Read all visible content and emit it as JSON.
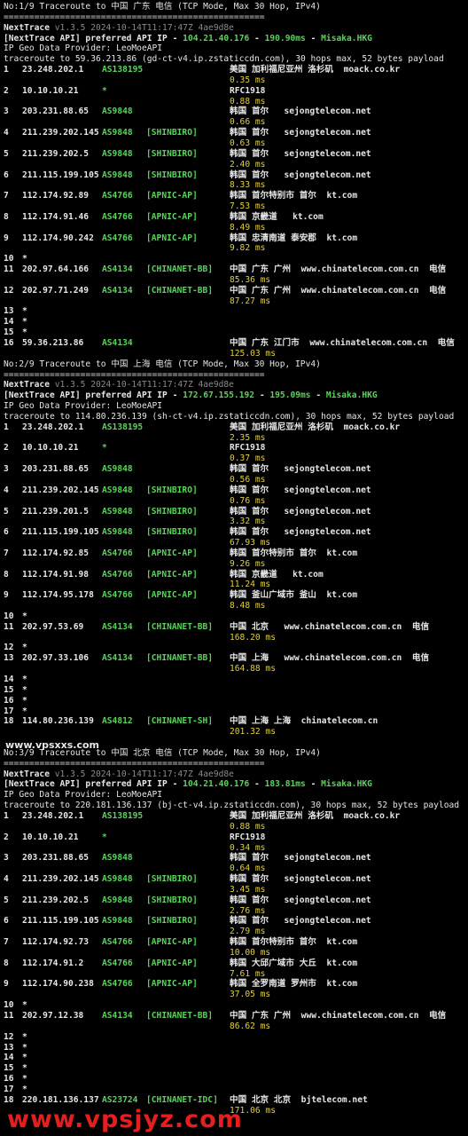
{
  "sections": [
    {
      "title": "No:1/9 Traceroute to 中国 广东 电信 (TCP Mode, Max 30 Hop, IPv4)",
      "rule": "===================================================",
      "version": "v1.3.5 2024-10-14T11:17:47Z 4ae9d8e",
      "api_ip": "104.21.40.176",
      "api_ms": "190.90ms",
      "api_name": "Misaka.HKG",
      "provider": "IP Geo Data Provider: LeoMoeAPI",
      "trace_line": "traceroute to 59.36.213.86 (gd-ct-v4.ip.zstaticcdn.com), 30 hops max, 52 bytes payload",
      "hops": [
        {
          "n": "1",
          "ip": "23.248.202.1",
          "as": "AS138195",
          "tag": "",
          "geo": "美国 加利福尼亚州 洛杉矶  moack.co.kr",
          "rtt": "0.35 ms"
        },
        {
          "n": "2",
          "ip": "10.10.10.21",
          "as": "*",
          "tag": "",
          "geo": "RFC1918",
          "rtt": "0.88 ms"
        },
        {
          "n": "3",
          "ip": "203.231.88.65",
          "as": "AS9848",
          "tag": "",
          "geo": "韩国 首尔   sejongtelecom.net",
          "rtt": "0.66 ms"
        },
        {
          "n": "4",
          "ip": "211.239.202.145",
          "as": "AS9848",
          "tag": "[SHINBIRO]",
          "geo": "韩国 首尔   sejongtelecom.net",
          "rtt": "0.63 ms"
        },
        {
          "n": "5",
          "ip": "211.239.202.5",
          "as": "AS9848",
          "tag": "[SHINBIRO]",
          "geo": "韩国 首尔   sejongtelecom.net",
          "rtt": "2.40 ms"
        },
        {
          "n": "6",
          "ip": "211.115.199.105",
          "as": "AS9848",
          "tag": "[SHINBIRO]",
          "geo": "韩国 首尔   sejongtelecom.net",
          "rtt": "8.33 ms"
        },
        {
          "n": "7",
          "ip": "112.174.92.89",
          "as": "AS4766",
          "tag": "[APNIC-AP]",
          "geo": "韩国 首尔特别市 首尔  kt.com",
          "rtt": "7.53 ms"
        },
        {
          "n": "8",
          "ip": "112.174.91.46",
          "as": "AS4766",
          "tag": "[APNIC-AP]",
          "geo": "韩国 京畿道   kt.com",
          "rtt": "8.49 ms"
        },
        {
          "n": "9",
          "ip": "112.174.90.242",
          "as": "AS4766",
          "tag": "[APNIC-AP]",
          "geo": "韩国 忠清南道 泰安郡  kt.com",
          "rtt": "9.82 ms"
        },
        {
          "n": "10",
          "ip": "*",
          "as": "",
          "tag": "",
          "geo": "",
          "rtt": ""
        },
        {
          "n": "11",
          "ip": "202.97.64.166",
          "as": "AS4134",
          "tag": "[CHINANET-BB]",
          "geo": "中国 广东 广州  www.chinatelecom.com.cn  电信",
          "rtt": "85.36 ms"
        },
        {
          "n": "12",
          "ip": "202.97.71.249",
          "as": "AS4134",
          "tag": "[CHINANET-BB]",
          "geo": "中国 广东 广州  www.chinatelecom.com.cn  电信",
          "rtt": "87.27 ms"
        },
        {
          "n": "13",
          "ip": "*",
          "as": "",
          "tag": "",
          "geo": "",
          "rtt": ""
        },
        {
          "n": "14",
          "ip": "*",
          "as": "",
          "tag": "",
          "geo": "",
          "rtt": ""
        },
        {
          "n": "15",
          "ip": "*",
          "as": "",
          "tag": "",
          "geo": "",
          "rtt": ""
        },
        {
          "n": "16",
          "ip": "59.36.213.86",
          "as": "AS4134",
          "tag": "",
          "geo": "中国 广东 江门市  www.chinatelecom.com.cn  电信",
          "rtt": "125.03 ms"
        }
      ]
    },
    {
      "title": "No:2/9 Traceroute to 中国 上海 电信 (TCP Mode, Max 30 Hop, IPv4)",
      "rule": "===================================================",
      "version": "v1.3.5 2024-10-14T11:17:47Z 4ae9d8e",
      "api_ip": "172.67.155.192",
      "api_ms": "195.09ms",
      "api_name": "Misaka.HKG",
      "provider": "IP Geo Data Provider: LeoMoeAPI",
      "trace_line": "traceroute to 114.80.236.139 (sh-ct-v4.ip.zstaticcdn.com), 30 hops max, 52 bytes payload",
      "hops": [
        {
          "n": "1",
          "ip": "23.248.202.1",
          "as": "AS138195",
          "tag": "",
          "geo": "美国 加利福尼亚州 洛杉矶  moack.co.kr",
          "rtt": "2.35 ms"
        },
        {
          "n": "2",
          "ip": "10.10.10.21",
          "as": "*",
          "tag": "",
          "geo": "RFC1918",
          "rtt": "0.37 ms"
        },
        {
          "n": "3",
          "ip": "203.231.88.65",
          "as": "AS9848",
          "tag": "",
          "geo": "韩国 首尔   sejongtelecom.net",
          "rtt": "0.56 ms"
        },
        {
          "n": "4",
          "ip": "211.239.202.145",
          "as": "AS9848",
          "tag": "[SHINBIRO]",
          "geo": "韩国 首尔   sejongtelecom.net",
          "rtt": "0.76 ms"
        },
        {
          "n": "5",
          "ip": "211.239.201.5",
          "as": "AS9848",
          "tag": "[SHINBIRO]",
          "geo": "韩国 首尔   sejongtelecom.net",
          "rtt": "3.32 ms"
        },
        {
          "n": "6",
          "ip": "211.115.199.105",
          "as": "AS9848",
          "tag": "[SHINBIRO]",
          "geo": "韩国 首尔   sejongtelecom.net",
          "rtt": "67.93 ms"
        },
        {
          "n": "7",
          "ip": "112.174.92.85",
          "as": "AS4766",
          "tag": "[APNIC-AP]",
          "geo": "韩国 首尔特别市 首尔  kt.com",
          "rtt": "9.26 ms"
        },
        {
          "n": "8",
          "ip": "112.174.91.98",
          "as": "AS4766",
          "tag": "[APNIC-AP]",
          "geo": "韩国 京畿道   kt.com",
          "rtt": "11.24 ms"
        },
        {
          "n": "9",
          "ip": "112.174.95.178",
          "as": "AS4766",
          "tag": "[APNIC-AP]",
          "geo": "韩国 釜山广域市 釜山  kt.com",
          "rtt": "8.48 ms"
        },
        {
          "n": "10",
          "ip": "*",
          "as": "",
          "tag": "",
          "geo": "",
          "rtt": ""
        },
        {
          "n": "11",
          "ip": "202.97.53.69",
          "as": "AS4134",
          "tag": "[CHINANET-BB]",
          "geo": "中国 北京   www.chinatelecom.com.cn  电信",
          "rtt": "168.20 ms"
        },
        {
          "n": "12",
          "ip": "*",
          "as": "",
          "tag": "",
          "geo": "",
          "rtt": ""
        },
        {
          "n": "13",
          "ip": "202.97.33.106",
          "as": "AS4134",
          "tag": "[CHINANET-BB]",
          "geo": "中国 上海   www.chinatelecom.com.cn  电信",
          "rtt": "164.88 ms"
        },
        {
          "n": "14",
          "ip": "*",
          "as": "",
          "tag": "",
          "geo": "",
          "rtt": ""
        },
        {
          "n": "15",
          "ip": "*",
          "as": "",
          "tag": "",
          "geo": "",
          "rtt": ""
        },
        {
          "n": "16",
          "ip": "*",
          "as": "",
          "tag": "",
          "geo": "",
          "rtt": ""
        },
        {
          "n": "17",
          "ip": "*",
          "as": "",
          "tag": "",
          "geo": "",
          "rtt": ""
        },
        {
          "n": "18",
          "ip": "114.80.236.139",
          "as": "AS4812",
          "tag": "[CHINANET-SH]",
          "geo": "中国 上海 上海  chinatelecom.cn",
          "rtt": "201.32 ms"
        }
      ]
    },
    {
      "title": "No:3/9 Traceroute to 中国 北京 电信 (TCP Mode, Max 30 Hop, IPv4)",
      "rule": "===================================================",
      "version": "v1.3.5 2024-10-14T11:17:47Z 4ae9d8e",
      "api_ip": "104.21.40.176",
      "api_ms": "183.81ms",
      "api_name": "Misaka.HKG",
      "provider": "IP Geo Data Provider: LeoMoeAPI",
      "trace_line": "traceroute to 220.181.136.137 (bj-ct-v4.ip.zstaticcdn.com), 30 hops max, 52 bytes payload",
      "hops": [
        {
          "n": "1",
          "ip": "23.248.202.1",
          "as": "AS138195",
          "tag": "",
          "geo": "美国 加利福尼亚州 洛杉矶  moack.co.kr",
          "rtt": "0.88 ms"
        },
        {
          "n": "2",
          "ip": "10.10.10.21",
          "as": "*",
          "tag": "",
          "geo": "RFC1918",
          "rtt": "0.34 ms"
        },
        {
          "n": "3",
          "ip": "203.231.88.65",
          "as": "AS9848",
          "tag": "",
          "geo": "韩国 首尔   sejongtelecom.net",
          "rtt": "0.64 ms"
        },
        {
          "n": "4",
          "ip": "211.239.202.145",
          "as": "AS9848",
          "tag": "[SHINBIRO]",
          "geo": "韩国 首尔   sejongtelecom.net",
          "rtt": "3.45 ms"
        },
        {
          "n": "5",
          "ip": "211.239.202.5",
          "as": "AS9848",
          "tag": "[SHINBIRO]",
          "geo": "韩国 首尔   sejongtelecom.net",
          "rtt": "2.76 ms"
        },
        {
          "n": "6",
          "ip": "211.115.199.105",
          "as": "AS9848",
          "tag": "[SHINBIRO]",
          "geo": "韩国 首尔   sejongtelecom.net",
          "rtt": "2.79 ms"
        },
        {
          "n": "7",
          "ip": "112.174.92.73",
          "as": "AS4766",
          "tag": "[APNIC-AP]",
          "geo": "韩国 首尔特别市 首尔  kt.com",
          "rtt": "10.00 ms"
        },
        {
          "n": "8",
          "ip": "112.174.91.2",
          "as": "AS4766",
          "tag": "[APNIC-AP]",
          "geo": "韩国 大邱广域市 大丘  kt.com",
          "rtt": "7.61 ms"
        },
        {
          "n": "9",
          "ip": "112.174.90.238",
          "as": "AS4766",
          "tag": "[APNIC-AP]",
          "geo": "韩国 全罗南道 罗州市  kt.com",
          "rtt": "37.05 ms"
        },
        {
          "n": "10",
          "ip": "*",
          "as": "",
          "tag": "",
          "geo": "",
          "rtt": ""
        },
        {
          "n": "11",
          "ip": "202.97.12.38",
          "as": "AS4134",
          "tag": "[CHINANET-BB]",
          "geo": "中国 广东 广州  www.chinatelecom.com.cn  电信",
          "rtt": "86.62 ms"
        },
        {
          "n": "12",
          "ip": "*",
          "as": "",
          "tag": "",
          "geo": "",
          "rtt": ""
        },
        {
          "n": "13",
          "ip": "*",
          "as": "",
          "tag": "",
          "geo": "",
          "rtt": ""
        },
        {
          "n": "14",
          "ip": "*",
          "as": "",
          "tag": "",
          "geo": "",
          "rtt": ""
        },
        {
          "n": "15",
          "ip": "*",
          "as": "",
          "tag": "",
          "geo": "",
          "rtt": ""
        },
        {
          "n": "16",
          "ip": "*",
          "as": "",
          "tag": "",
          "geo": "",
          "rtt": ""
        },
        {
          "n": "17",
          "ip": "*",
          "as": "",
          "tag": "",
          "geo": "",
          "rtt": ""
        },
        {
          "n": "18",
          "ip": "220.181.136.137",
          "as": "AS23724",
          "tag": "[CHINANET-IDC]",
          "geo": "中国 北京 北京  bjtelecom.net",
          "rtt": "171.06 ms"
        }
      ]
    }
  ],
  "labels": {
    "nexttrace": "NextTrace",
    "api_prefix": "[NextTrace API]",
    "api_text": " preferred API IP - ",
    "sep": " - "
  },
  "site_mark": "www.vpsxxs.com",
  "watermark": "www.vpsjyz.com"
}
